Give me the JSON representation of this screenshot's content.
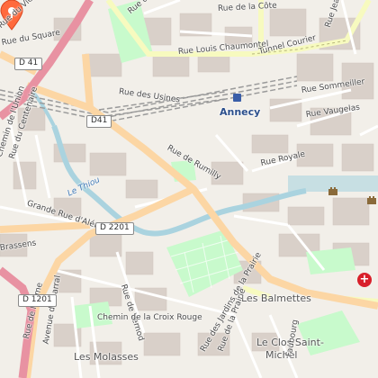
{
  "map": {
    "type": "street-map",
    "colors": {
      "background": "#f2efe9",
      "building": "#d9d0c9",
      "primary_road": "#fcd6a4",
      "secondary_road": "#f7fabf",
      "motorway": "#e892a2",
      "water": "#aad3df",
      "park": "#c8facc",
      "railway": "#9a9a9a",
      "marker": "#ff6a3d"
    },
    "place": {
      "city": "Annecy",
      "balmettes": "Les Balmettes",
      "molasses": "Les Molasses",
      "clos_l1": "Le Clos Saint-",
      "clos_l2": "Michel"
    },
    "streets": {
      "voyrier": "Rue du Vieux Voyrier",
      "square": "Rue du Square",
      "louis_chaumontel": "Rue Louis Chaumontel",
      "tunnel_courier": "Tunnel Courier",
      "usines": "Rue des Usines",
      "sommeiller": "Rue Sommeiller",
      "vaugelas": "Rue Vaugelas",
      "royale": "Rue Royale",
      "rumilly": "Rue de Rumilly",
      "union": "Chemin de l'Union",
      "centenaire": "Rue du Centenaire",
      "grande_alery": "Grande Rue d'Aléry",
      "brassens": "Brassens",
      "vernod": "Rue de Vernod",
      "croix_rouge": "Chemin de la Croix Rouge",
      "orme": "Rue de l'Orme",
      "barral": "Avenue de Barral",
      "jardins": "Rue des Jardins de la Prairie",
      "prairie": "Rue de la Prairie",
      "jean_jaures": "Rue Jean Jaurès",
      "se": "Rue de Se",
      "cote": "Rue de la Côte",
      "faubourg": "Faubourg"
    },
    "water": {
      "thiou": "Le Thiou"
    },
    "roads": {
      "d41a": "D 41",
      "d41b": "D41",
      "d2201": "D 2201",
      "d1201": "D 1201"
    },
    "icons": {
      "marker": "map-pin-icon",
      "station": "train-station-icon",
      "hospital": "hospital-icon",
      "castle": "castle-icon"
    },
    "hospital_symbol": "+"
  }
}
